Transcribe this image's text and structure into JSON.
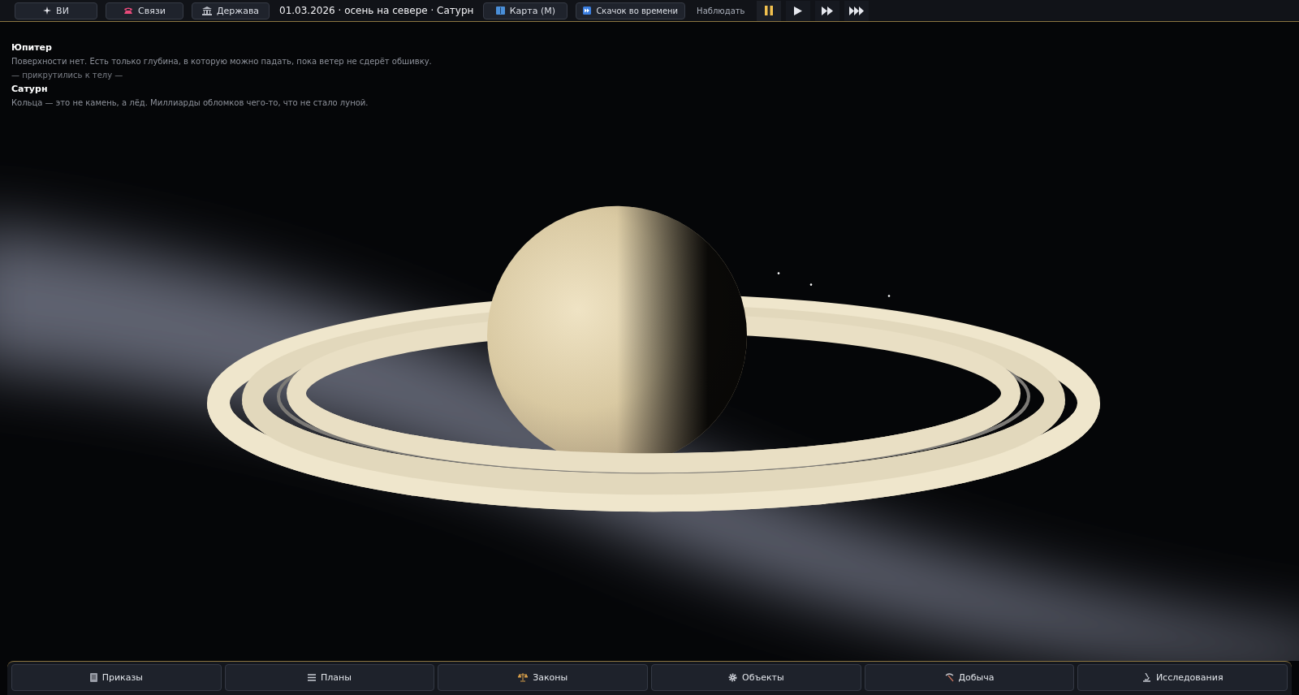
{
  "top_bar": {
    "buttons": [
      {
        "label": "ВИ"
      },
      {
        "label": "Связи"
      },
      {
        "label": "Держава"
      }
    ],
    "status": "01.03.2026 · осень на севере · Сатурн",
    "tools": [
      {
        "label": "Карта (M)"
      },
      {
        "label": "Скачок во времени"
      }
    ],
    "mode": "Наблюдать",
    "speed_controls": [
      {
        "kind": "pause",
        "selected": true
      },
      {
        "kind": "play",
        "selected": false
      },
      {
        "kind": "fast",
        "selected": false
      },
      {
        "kind": "fastest",
        "selected": false
      }
    ]
  },
  "log": [
    {
      "kind": "title",
      "text": "Юпитер"
    },
    {
      "kind": "text",
      "text": "Поверхности нет. Есть только глубина, в которую можно падать, пока ветер не сдерёт обшивку."
    },
    {
      "kind": "note",
      "text": "— прикрутились к телу —"
    },
    {
      "kind": "title",
      "text": "Сатурн"
    },
    {
      "kind": "text",
      "text": "Кольца — это не камень, а лёд. Миллиарды обломков чего-то, что не стало луной."
    }
  ],
  "bottom_nav": [
    {
      "label": "Приказы"
    },
    {
      "label": "Планы"
    },
    {
      "label": "Законы"
    },
    {
      "label": "Объекты"
    },
    {
      "label": "Добыча"
    },
    {
      "label": "Исследования"
    }
  ]
}
